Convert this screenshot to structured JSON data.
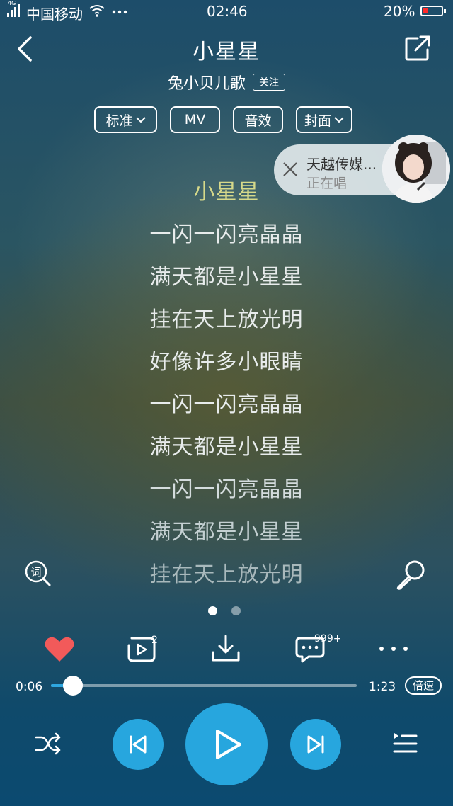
{
  "status_bar": {
    "network": "4G",
    "carrier": "中国移动",
    "time": "02:46",
    "battery": "20%"
  },
  "header": {
    "title": "小星星",
    "artist": "兔小贝儿歌",
    "follow_label": "关注"
  },
  "options": {
    "quality": "标准",
    "mv": "MV",
    "effect": "音效",
    "cover": "封面"
  },
  "singer_popup": {
    "name": "天越传媒...",
    "status": "正在唱"
  },
  "lyrics": [
    "小星星",
    "一闪一闪亮晶晶",
    "满天都是小星星",
    "挂在天上放光明",
    "好像许多小眼睛",
    "一闪一闪亮晶晶",
    "满天都是小星星",
    "一闪一闪亮晶晶",
    "满天都是小星星",
    "挂在天上放光明"
  ],
  "lyric_colors": {
    "active": "#d6d98a",
    "normal": "#e8ecec",
    "faded": "#a9b9bc"
  },
  "pager": {
    "pages": 2,
    "current": 1
  },
  "actions": {
    "video_count": "2",
    "comment_count": "999+"
  },
  "player": {
    "current_time": "0:06",
    "total_time": "1:23",
    "progress": 0.072,
    "speed_label": "倍速"
  },
  "colors": {
    "accent": "#27a6de",
    "like": "#f25a5a"
  }
}
